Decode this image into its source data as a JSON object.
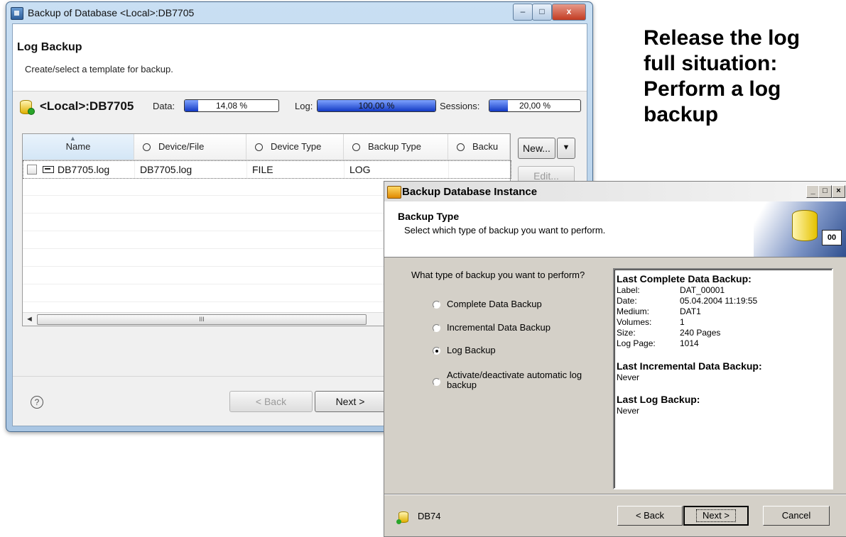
{
  "slide": {
    "lines": [
      "Release the log",
      "full situation:",
      "Perform a log",
      "backup"
    ]
  },
  "window1": {
    "title": "Backup of Database <Local>:DB7705",
    "controls": {
      "minimize": "–",
      "maximize": "□",
      "close": "x"
    },
    "heading": "Log Backup",
    "subheading": "Create/select a template for backup.",
    "db_name": "<Local>:DB7705",
    "meters": {
      "data": {
        "label": "Data:",
        "text": "14,08 %",
        "fraction": 0.1408
      },
      "log": {
        "label": "Log:",
        "text": "100,00 %",
        "fraction": 1.0
      },
      "sessions": {
        "label": "Sessions:",
        "text": "20,00 %",
        "fraction": 0.2
      }
    },
    "table": {
      "columns": [
        "Name",
        "Device/File",
        "Device Type",
        "Backup Type",
        "Backu"
      ],
      "rows": [
        {
          "name": "DB7705.log",
          "device_file": "DB7705.log",
          "device_type": "FILE",
          "backup_type": "LOG"
        }
      ],
      "scroll_grip": "III"
    },
    "buttons": {
      "new": "New...",
      "new_dropdown": "▼",
      "edit": "Edit...",
      "back": "< Back",
      "next": "Next >"
    },
    "help": "?"
  },
  "window2": {
    "title": "Backup Database Instance",
    "controls": {
      "minimize": "_",
      "maximize": "□",
      "close": "×"
    },
    "heading": "Backup Type",
    "subheading": "Select which type of backup you want to perform.",
    "question": "What type of backup you want to perform?",
    "options": [
      {
        "label": "Complete Data Backup",
        "selected": false
      },
      {
        "label": "Incremental  Data Backup",
        "selected": false
      },
      {
        "label": "Log Backup",
        "selected": true
      },
      {
        "label": "Activate/deactivate automatic log backup",
        "selected": false
      }
    ],
    "info": {
      "complete_title": "Last Complete Data Backup:",
      "fields": [
        {
          "key": "Label:",
          "value": "DAT_00001"
        },
        {
          "key": "Date:",
          "value": "05.04.2004 11:19:55"
        },
        {
          "key": "Medium:",
          "value": "DAT1"
        },
        {
          "key": "Volumes:",
          "value": "1"
        },
        {
          "key": "Size:",
          "value": "240 Pages"
        },
        {
          "key": "Log Page:",
          "value": "1014"
        }
      ],
      "incremental_title": "Last Incremental Data Backup:",
      "incremental_value": "Never",
      "log_title": "Last Log Backup:",
      "log_value": "Never"
    },
    "footer_db": "DB74",
    "tape_label": "00",
    "buttons": {
      "back": "< Back",
      "next": "Next >",
      "cancel": "Cancel"
    }
  }
}
